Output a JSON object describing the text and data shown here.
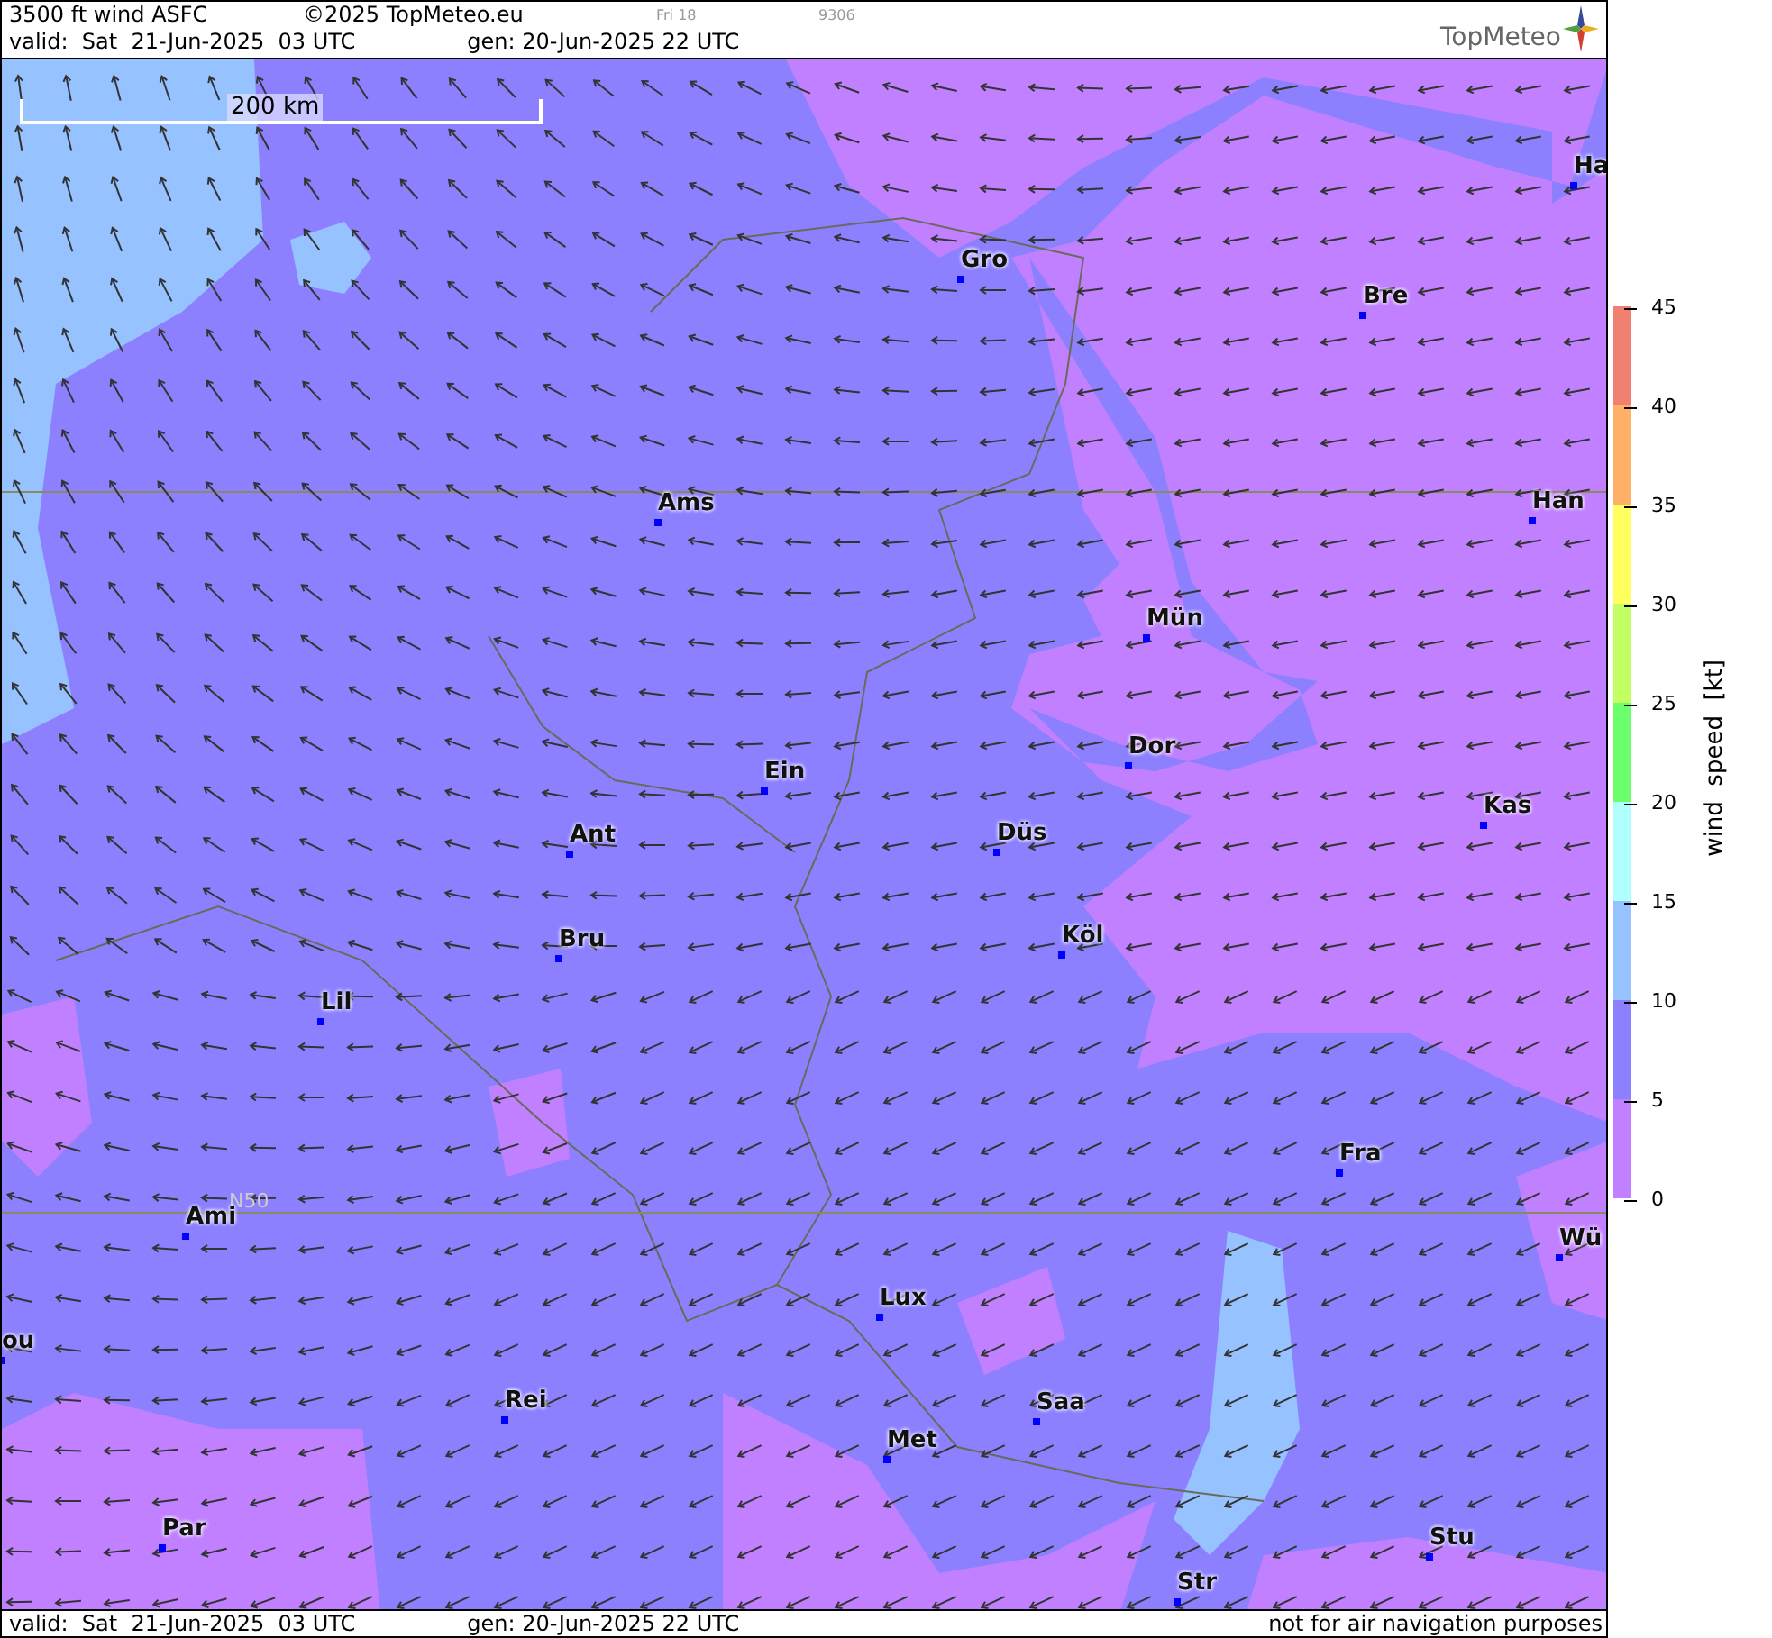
{
  "header": {
    "title": "3500 ft wind ASFC",
    "copyright": "©2025 TopMeteo.eu",
    "day": "Fri 18",
    "code": "9306",
    "valid": "valid:  Sat  21-Jun-2025  03 UTC",
    "gen": "gen: 20-Jun-2025 22 UTC",
    "logo": "TopMeteo"
  },
  "map": {
    "scale_bar": "200 km",
    "latitude_label": "N50",
    "cities": [
      {
        "name": "Ha"
      },
      {
        "name": "Gro"
      },
      {
        "name": "Bre"
      },
      {
        "name": "Ams"
      },
      {
        "name": "Han"
      },
      {
        "name": "Mün"
      },
      {
        "name": "Dor"
      },
      {
        "name": "Ein"
      },
      {
        "name": "Kas"
      },
      {
        "name": "Düs"
      },
      {
        "name": "Ant"
      },
      {
        "name": "Köl"
      },
      {
        "name": "Bru"
      },
      {
        "name": "Lil"
      },
      {
        "name": "Fra"
      },
      {
        "name": "Ami"
      },
      {
        "name": "Wü"
      },
      {
        "name": "Lux"
      },
      {
        "name": "ou"
      },
      {
        "name": "Rei"
      },
      {
        "name": "Saa"
      },
      {
        "name": "Met"
      },
      {
        "name": "Par"
      },
      {
        "name": "Stu"
      },
      {
        "name": "Str"
      }
    ]
  },
  "legend": {
    "title": "wind  speed  [kt]",
    "ticks": [
      "45",
      "40",
      "35",
      "30",
      "25",
      "20",
      "15",
      "10",
      "5",
      "0"
    ],
    "bins": [
      {
        "color": "#f08070"
      },
      {
        "color": "#ffb066"
      },
      {
        "color": "#ffff60"
      },
      {
        "color": "#c2ff62"
      },
      {
        "color": "#6cff6c"
      },
      {
        "color": "#b0ffff"
      },
      {
        "color": "#96c2ff"
      },
      {
        "color": "#8c80ff"
      },
      {
        "color": "#c080ff"
      }
    ]
  },
  "footer": {
    "valid": "valid:  Sat  21-Jun-2025  03 UTC",
    "gen": "gen: 20-Jun-2025 22 UTC",
    "note": "not for air navigation purposes"
  }
}
